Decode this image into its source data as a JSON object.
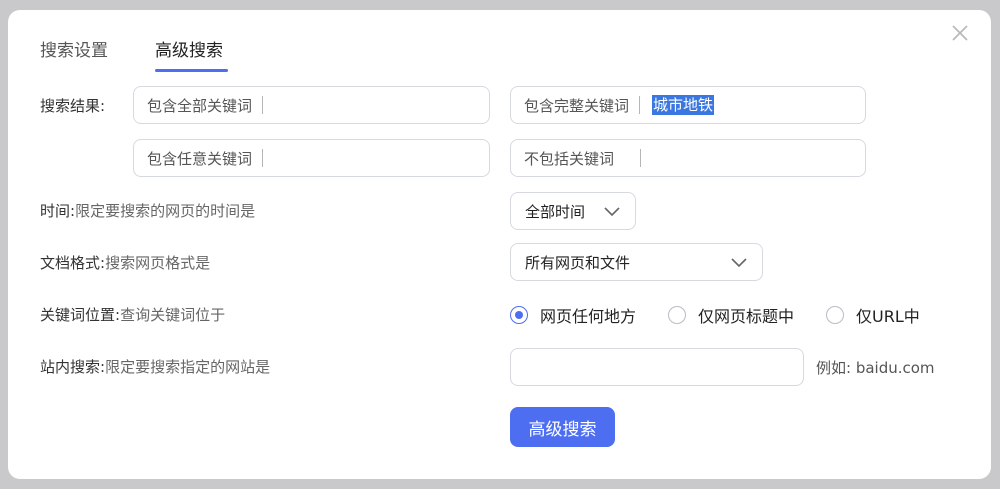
{
  "tabs": [
    {
      "label": "搜索设置",
      "active": false
    },
    {
      "label": "高级搜索",
      "active": true
    }
  ],
  "close_icon": "close-icon",
  "accent_color": "#4e6ef2",
  "keywords": {
    "label": "搜索结果:",
    "all_placeholder": "包含全部关键词",
    "all_value": "",
    "exact_placeholder": "包含完整关键词",
    "exact_value": "城市地铁",
    "any_placeholder": "包含任意关键词",
    "any_value": "",
    "exclude_placeholder": "不包括关键词",
    "exclude_value": ""
  },
  "time": {
    "label": "时间:",
    "desc": "限定要搜索的网页的时间是",
    "selected": "全部时间"
  },
  "format": {
    "label": "文档格式:",
    "desc": "搜索网页格式是",
    "selected": "所有网页和文件"
  },
  "position": {
    "label": "关键词位置:",
    "desc": "查询关键词位于",
    "options": [
      {
        "label": "网页任何地方",
        "checked": true
      },
      {
        "label": "仅网页标题中",
        "checked": false
      },
      {
        "label": "仅URL中",
        "checked": false
      }
    ]
  },
  "site": {
    "label": "站内搜索:",
    "desc": "限定要搜索指定的网站是",
    "value": "",
    "example": "例如: baidu.com"
  },
  "submit_label": "高级搜索"
}
